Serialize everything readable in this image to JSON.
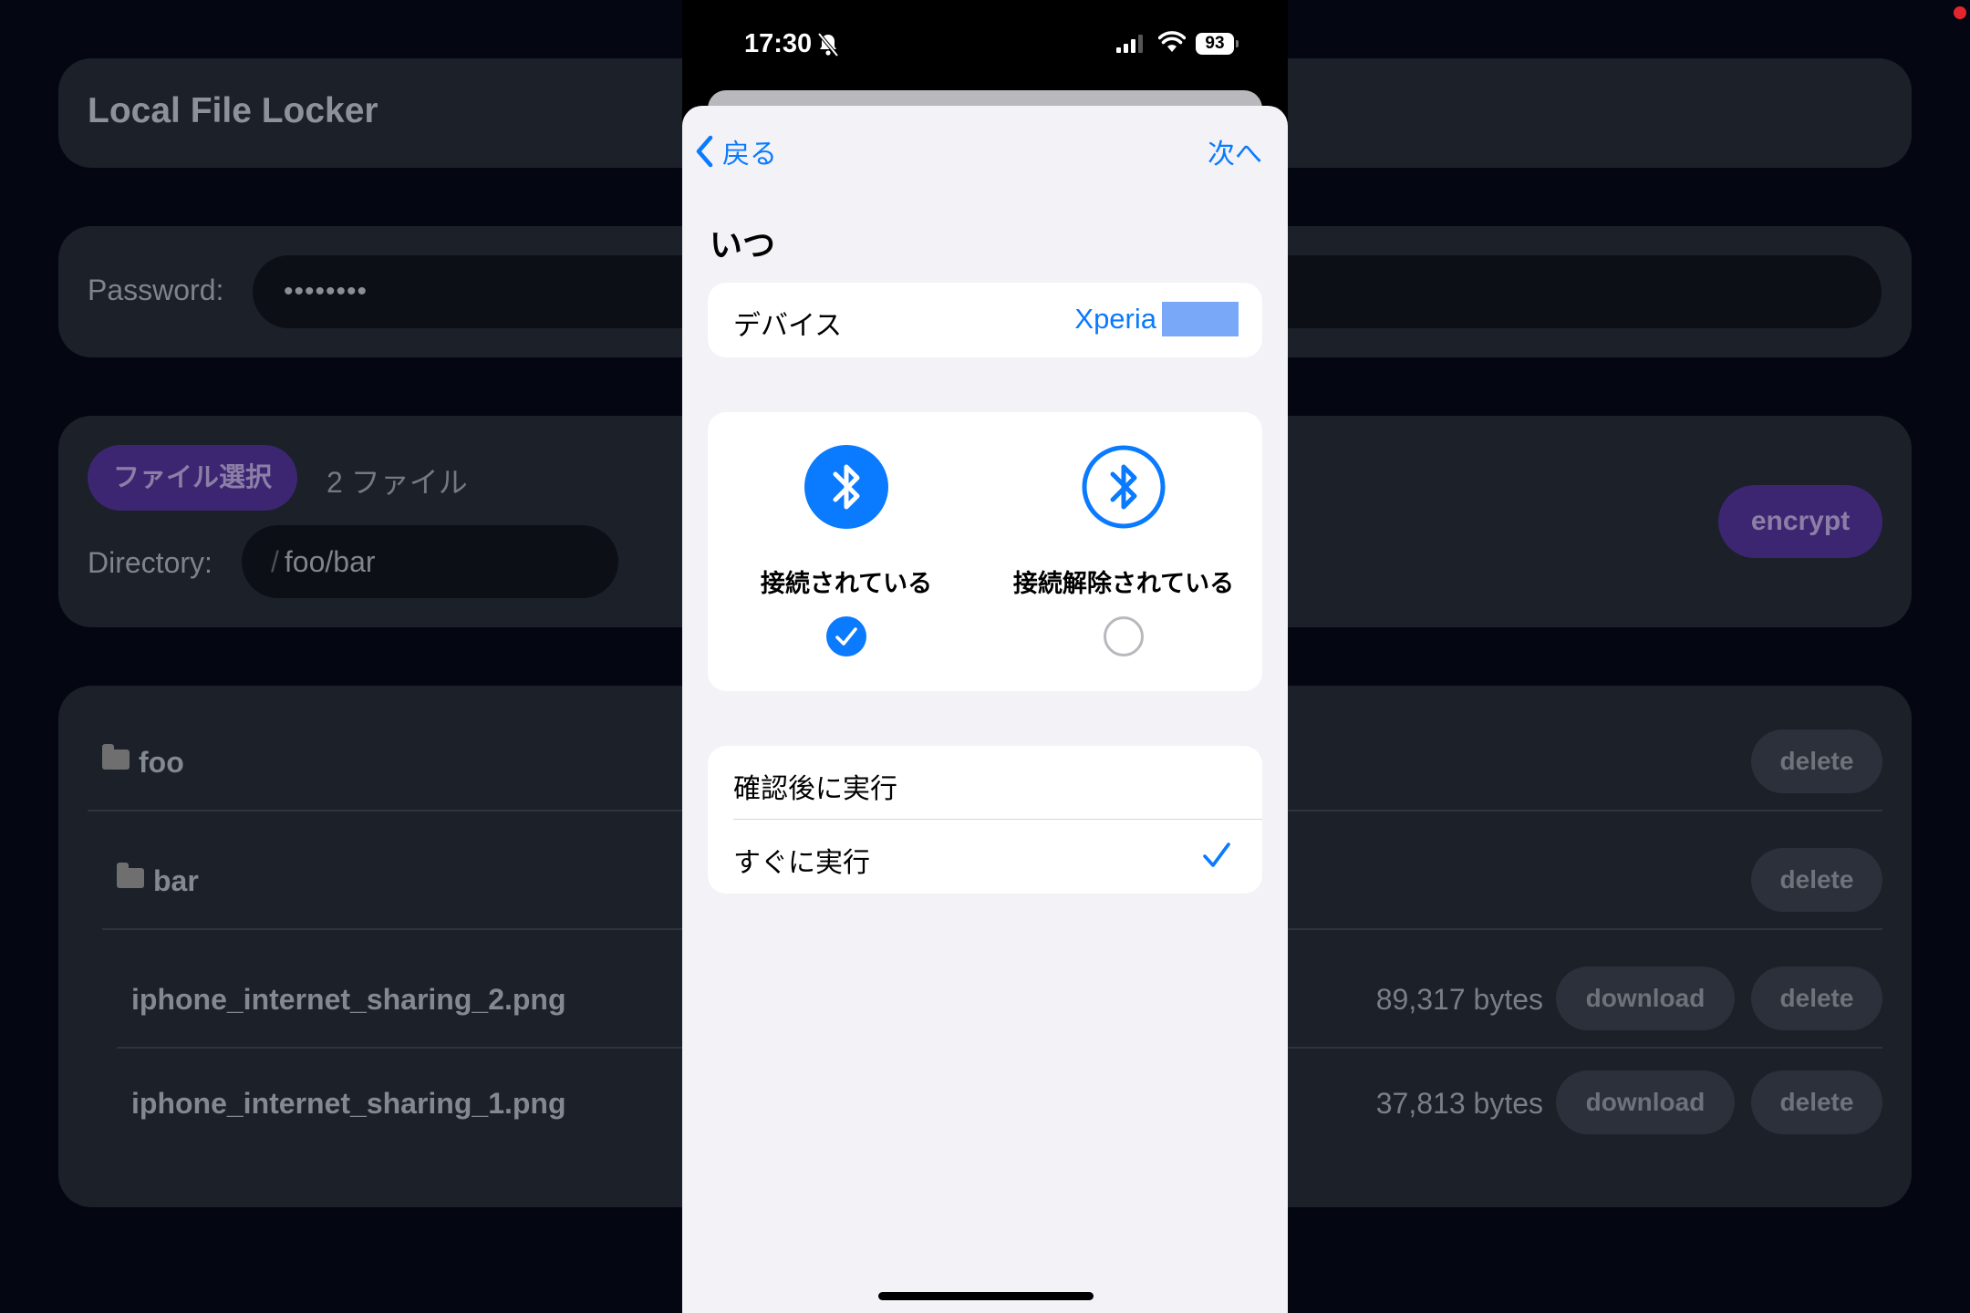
{
  "app": {
    "title": "Local File Locker",
    "password_label": "Password:",
    "password_value": "••••••••",
    "file_button": "ファイル選択",
    "file_count": "2 ファイル",
    "directory_label": "Directory:",
    "directory_slash": "/",
    "directory_value": "foo/bar",
    "encrypt_label": "encrypt",
    "accent_color": "#3c2672",
    "rows": [
      {
        "name": "foo",
        "type": "folder",
        "delete_label": "delete"
      },
      {
        "name": "bar",
        "type": "folder",
        "delete_label": "delete"
      },
      {
        "name": "iphone_internet_sharing_2.png",
        "type": "file",
        "size": "89,317 bytes",
        "download_label": "download",
        "delete_label": "delete"
      },
      {
        "name": "iphone_internet_sharing_1.png",
        "type": "file",
        "size": "37,813 bytes",
        "download_label": "download",
        "delete_label": "delete"
      }
    ]
  },
  "phone": {
    "status": {
      "time": "17:30",
      "battery": "93",
      "icons": [
        "bell-slash-icon",
        "cellular-signal-icon",
        "wifi-icon",
        "battery-icon"
      ]
    },
    "nav": {
      "back_label": "戻る",
      "next_label": "次へ"
    },
    "section_title": "いつ",
    "device": {
      "label": "デバイス",
      "value": "Xperia"
    },
    "bluetooth": [
      {
        "label": "接続されている",
        "selected": true,
        "icon": "bluetooth-filled-icon"
      },
      {
        "label": "接続解除されている",
        "selected": false,
        "icon": "bluetooth-outline-icon"
      }
    ],
    "run_options": [
      {
        "label": "確認後に実行",
        "selected": false
      },
      {
        "label": "すぐに実行",
        "selected": true
      }
    ],
    "accent_color": "#0a7aff"
  }
}
